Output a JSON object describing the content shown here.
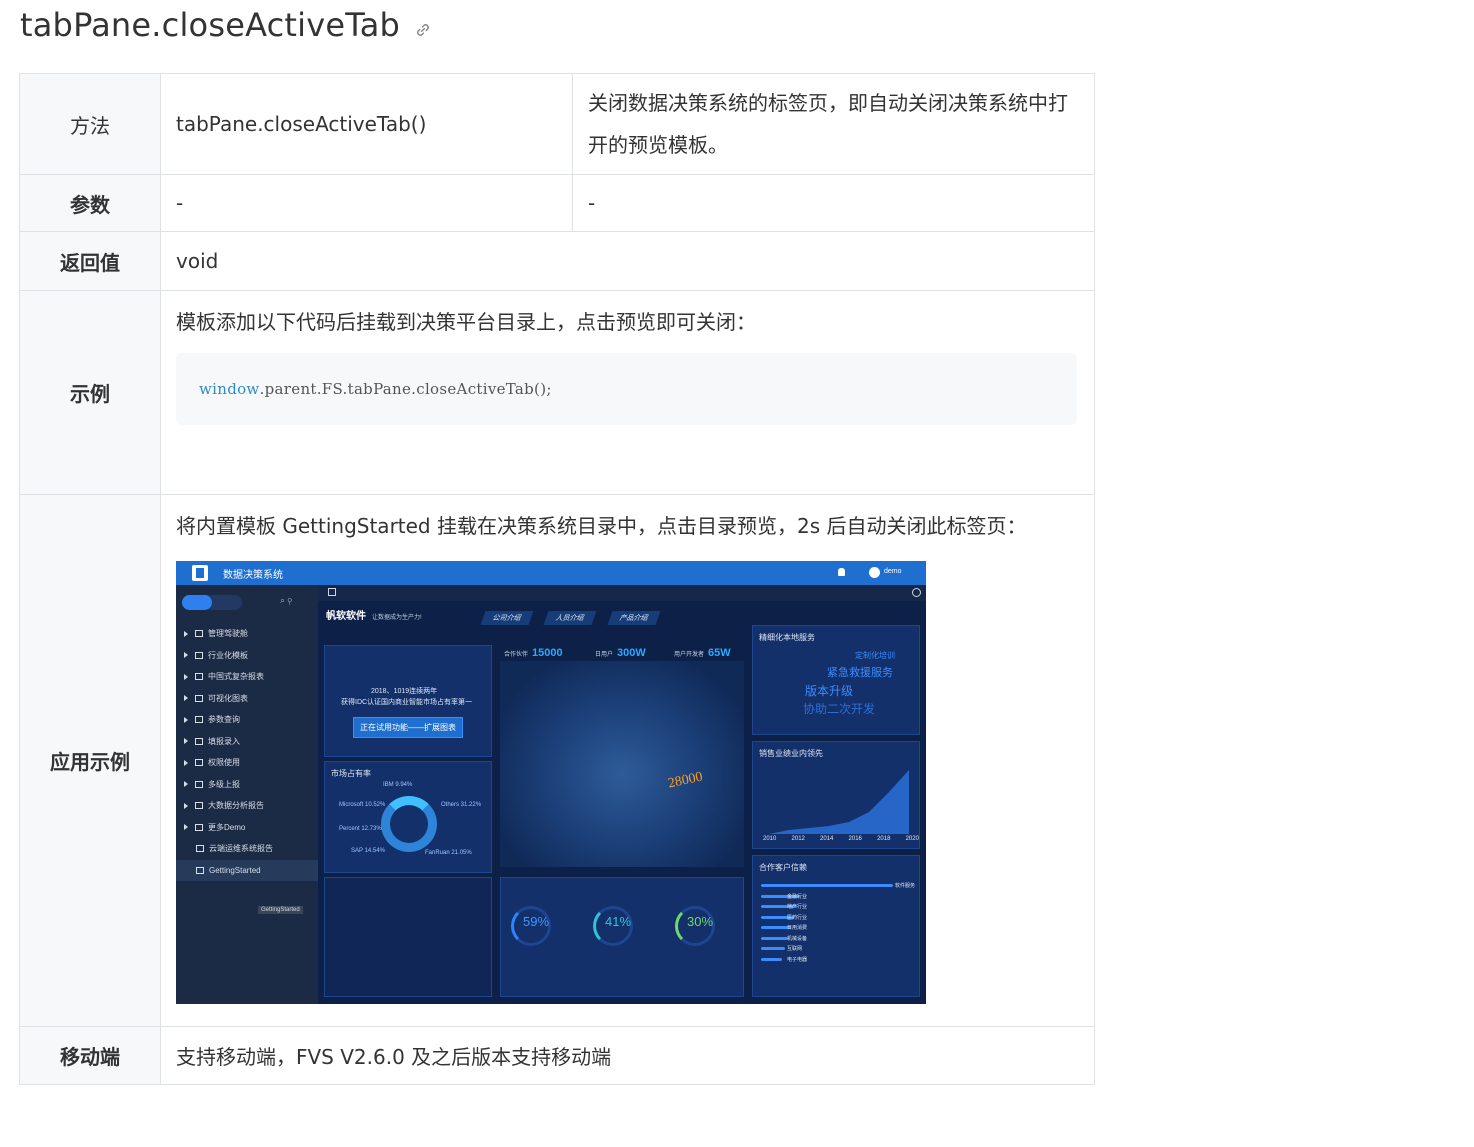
{
  "page": {
    "title": "tabPane.closeActiveTab"
  },
  "table": {
    "rows": {
      "method": {
        "label": "方法",
        "value": "tabPane.closeActiveTab()",
        "desc": "关闭数据决策系统的标签页，即自动关闭决策系统中打开的预览模板。"
      },
      "params": {
        "label": "参数",
        "value": "-",
        "desc": "-"
      },
      "returns": {
        "label": "返回值",
        "value": "void"
      },
      "example": {
        "label": "示例",
        "text": "模板添加以下代码后挂载到决策平台目录上，点击预览即可关闭：",
        "code_keyword": "window",
        "code_rest": ".parent.FS.tabPane.closeActiveTab();"
      },
      "application": {
        "label": "应用示例",
        "text": "将内置模板 GettingStarted 挂载在决策系统目录中，点击目录预览，2s 后自动关闭此标签页："
      },
      "mobile": {
        "label": "移动端",
        "value": "支持移动端，FVS V2.6.0 及之后版本支持移动端"
      }
    }
  },
  "screenshot": {
    "system_name": "数据决策系统",
    "user": "demo",
    "sidebar_items": [
      "管理驾驶舱",
      "行业化模板",
      "中国式复杂报表",
      "可视化图表",
      "参数查询",
      "填报录入",
      "权限使用",
      "多级上报",
      "大数据分析报告",
      "更多Demo"
    ],
    "sidebar_children": [
      "云端运维系统报告",
      "GettingStarted"
    ],
    "tooltip": "GettingStarted",
    "brand": "帆软软件",
    "slogan": "让数据成为生产力!",
    "nav_tabs": [
      "公司介绍",
      "人员介绍",
      "产品介绍"
    ],
    "stats": [
      {
        "label": "合作伙伴",
        "value": "15000"
      },
      {
        "label": "日用户",
        "value": "300W"
      },
      {
        "label": "用户开发者",
        "value": "65W"
      }
    ],
    "left_panel_line1": "2018、1019连续两年",
    "left_panel_line2": "获得IDC认证国内商业智能市场占有率第一",
    "cta": "正在试用功能——扩展图表",
    "market_title": "市场占有率",
    "market_labels": [
      "IBM 9.94%",
      "Microsoft 10.52%",
      "Others 31.22%",
      "Percent 12.73%",
      "SAP 14.54%",
      "FanRuan 21.05%"
    ],
    "map_number": "28000",
    "service_title": "精细化本地服务",
    "service_words": [
      "定制化培训",
      "紧急救援服务",
      "版本升级",
      "协助二次开发"
    ],
    "sales_title": "销售业绩业内领先",
    "sales_years": [
      "2010",
      "2012",
      "2014",
      "2016",
      "2018",
      "2020"
    ],
    "percents": [
      "59%",
      "41%",
      "30%"
    ],
    "trust_title": "合作客户信赖",
    "trust_items": [
      "软件服务",
      "金融行业",
      "地产行业",
      "医药行业",
      "日用消费",
      "机械设备",
      "互联网",
      "电子电器"
    ]
  }
}
